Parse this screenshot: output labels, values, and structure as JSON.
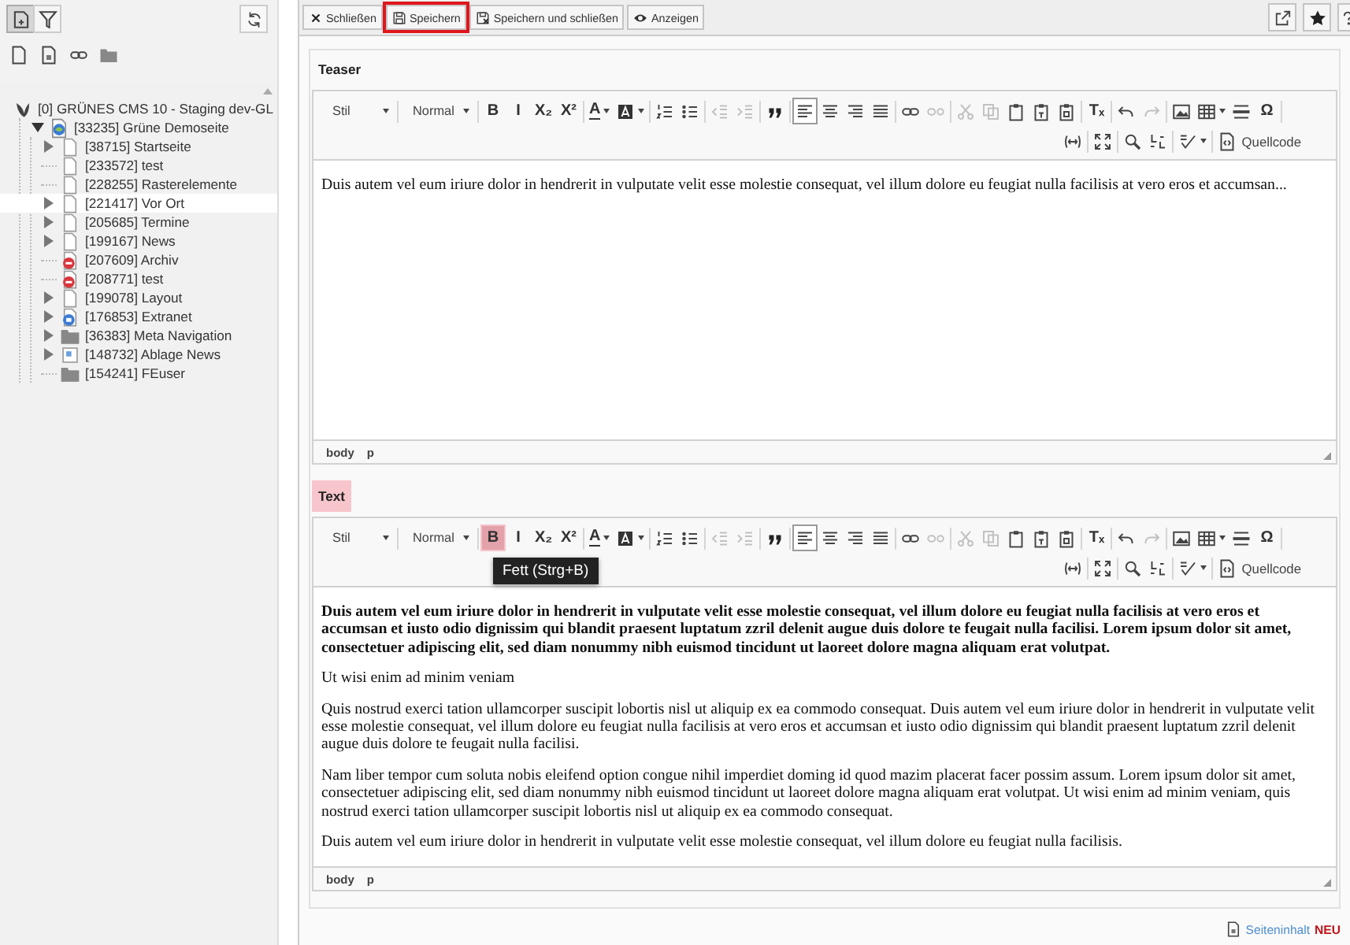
{
  "sidebar": {
    "toolbar": [
      {
        "selected": true
      },
      {
        "selected": false
      }
    ],
    "tree": {
      "label": "[0] GRÜNES CMS 10 - Staging dev-GL",
      "kind": "site",
      "selected": false,
      "children": [
        {
          "label": "[33235] Grüne Demoseite",
          "kind": "home",
          "expanded": true,
          "selected": false,
          "children": [
            {
              "label": "[38715] Startseite",
              "kind": "page",
              "expanded": false,
              "selected": false
            },
            {
              "label": "[233572] test",
              "kind": "page",
              "selected": false
            },
            {
              "label": "[228255] Rasterelemente",
              "kind": "page",
              "selected": false
            },
            {
              "label": "[221417] Vor Ort",
              "kind": "page",
              "expanded": false,
              "selected": true
            },
            {
              "label": "[205685] Termine",
              "kind": "page",
              "expanded": false,
              "selected": false
            },
            {
              "label": "[199167] News",
              "kind": "page",
              "expanded": false,
              "selected": false
            },
            {
              "label": "[207609] Archiv",
              "kind": "restricted",
              "selected": false
            },
            {
              "label": "[208771] test",
              "kind": "restricted",
              "selected": false
            },
            {
              "label": "[199078] Layout",
              "kind": "page",
              "expanded": false,
              "selected": false
            },
            {
              "label": "[176853] Extranet",
              "kind": "extranet",
              "expanded": false,
              "selected": false
            },
            {
              "label": "[36383] Meta Navigation",
              "kind": "folder",
              "expanded": false,
              "selected": false
            },
            {
              "label": "[148732] Ablage News",
              "kind": "news",
              "expanded": false,
              "selected": false
            },
            {
              "label": "[154241] FEuser",
              "kind": "folder",
              "selected": false
            }
          ]
        }
      ]
    }
  },
  "doc_header": {
    "buttons": [
      {
        "label": "Schließen",
        "focused": false
      },
      {
        "label": "Speichern",
        "focused": true
      },
      {
        "label": "Speichern und schließen",
        "focused": false
      },
      {
        "label": "Anzeigen",
        "focused": false
      }
    ]
  },
  "editors": [
    {
      "label": "Teaser",
      "highlighted": false,
      "toolbar": [
        [
          {
            "kind": "dropdown",
            "text": "Stil"
          },
          {
            "kind": "dropdown",
            "text": "Normal"
          },
          {
            "kind": "button",
            "text": "B",
            "disabled": false,
            "on": false,
            "hover": false
          },
          {
            "kind": "button",
            "text": "I",
            "disabled": false,
            "on": false,
            "hover": false
          },
          {
            "kind": "button",
            "text": "X₂",
            "disabled": false,
            "on": false,
            "hover": false
          },
          {
            "kind": "button",
            "text": "X²",
            "disabled": false,
            "on": false,
            "hover": false
          },
          {
            "kind": "button",
            "text": "A",
            "disabled": false,
            "on": false,
            "hover": false
          },
          {
            "kind": "button",
            "disabled": false,
            "on": false,
            "hover": false
          },
          {
            "kind": "button",
            "disabled": false,
            "on": false,
            "hover": false
          },
          {
            "kind": "button",
            "disabled": false,
            "on": false,
            "hover": false
          },
          {
            "kind": "button",
            "disabled": true,
            "on": false,
            "hover": false
          },
          {
            "kind": "button",
            "disabled": true,
            "on": false,
            "hover": false
          },
          {
            "kind": "button",
            "disabled": false,
            "on": false,
            "hover": false
          },
          {
            "kind": "button",
            "disabled": false,
            "on": true,
            "hover": false
          },
          {
            "kind": "button",
            "disabled": false,
            "on": false,
            "hover": false
          },
          {
            "kind": "button",
            "disabled": false,
            "on": false,
            "hover": false
          },
          {
            "kind": "button",
            "disabled": false,
            "on": false,
            "hover": false
          },
          {
            "kind": "button",
            "disabled": false,
            "on": false,
            "hover": false
          },
          {
            "kind": "button",
            "disabled": true,
            "on": false,
            "hover": false
          },
          {
            "kind": "button",
            "disabled": true,
            "on": false,
            "hover": false
          },
          {
            "kind": "button",
            "disabled": true,
            "on": false,
            "hover": false
          },
          {
            "kind": "button",
            "disabled": false,
            "on": false,
            "hover": false
          },
          {
            "kind": "button",
            "disabled": false,
            "on": false,
            "hover": false
          },
          {
            "kind": "button",
            "disabled": false,
            "on": false,
            "hover": false
          },
          {
            "kind": "button",
            "text": "Tₓ",
            "disabled": false,
            "on": false,
            "hover": false
          },
          {
            "kind": "button",
            "disabled": false,
            "on": false,
            "hover": false
          },
          {
            "kind": "button",
            "disabled": true,
            "on": false,
            "hover": false
          },
          {
            "kind": "button",
            "disabled": false,
            "on": false,
            "hover": false
          },
          {
            "kind": "button",
            "disabled": false,
            "on": false,
            "hover": false
          },
          {
            "kind": "button",
            "disabled": false,
            "on": false,
            "hover": false
          },
          {
            "kind": "button",
            "text": "Ω",
            "disabled": false,
            "on": false,
            "hover": false
          }
        ],
        [
          {
            "kind": "button",
            "disabled": false,
            "on": false,
            "hover": false
          },
          {
            "kind": "button",
            "disabled": false,
            "on": false,
            "hover": false
          },
          {
            "kind": "button",
            "disabled": false,
            "on": false,
            "hover": false
          },
          {
            "kind": "button",
            "disabled": false,
            "on": false,
            "hover": false
          },
          {
            "kind": "button",
            "disabled": false,
            "on": false,
            "hover": false
          },
          {
            "kind": "button",
            "text": "Quellcode",
            "disabled": false,
            "on": false,
            "hover": false
          }
        ]
      ],
      "paragraphs": [
        {
          "text": "Duis autem vel eum iriure dolor in hendrerit in vulputate velit esse molestie consequat, vel illum dolore eu feugiat nulla facilisis at vero eros et accumsan...",
          "bold": false
        }
      ],
      "path": [
        "body",
        "p"
      ]
    },
    {
      "label": "Text",
      "highlighted": true,
      "toolbar": [
        [
          {
            "kind": "dropdown",
            "text": "Stil"
          },
          {
            "kind": "dropdown",
            "text": "Normal"
          },
          {
            "kind": "button",
            "text": "B",
            "disabled": false,
            "on": false,
            "hover": true,
            "tooltip": "Fett (Strg+B)"
          },
          {
            "kind": "button",
            "text": "I",
            "disabled": false,
            "on": false,
            "hover": false
          },
          {
            "kind": "button",
            "text": "X₂",
            "disabled": false,
            "on": false,
            "hover": false
          },
          {
            "kind": "button",
            "text": "X²",
            "disabled": false,
            "on": false,
            "hover": false
          },
          {
            "kind": "button",
            "text": "A",
            "disabled": false,
            "on": false,
            "hover": false
          },
          {
            "kind": "button",
            "disabled": false,
            "on": false,
            "hover": false
          },
          {
            "kind": "button",
            "disabled": false,
            "on": false,
            "hover": false
          },
          {
            "kind": "button",
            "disabled": false,
            "on": false,
            "hover": false
          },
          {
            "kind": "button",
            "disabled": true,
            "on": false,
            "hover": false
          },
          {
            "kind": "button",
            "disabled": true,
            "on": false,
            "hover": false
          },
          {
            "kind": "button",
            "disabled": false,
            "on": false,
            "hover": false
          },
          {
            "kind": "button",
            "disabled": false,
            "on": true,
            "hover": false
          },
          {
            "kind": "button",
            "disabled": false,
            "on": false,
            "hover": false
          },
          {
            "kind": "button",
            "disabled": false,
            "on": false,
            "hover": false
          },
          {
            "kind": "button",
            "disabled": false,
            "on": false,
            "hover": false
          },
          {
            "kind": "button",
            "disabled": false,
            "on": false,
            "hover": false
          },
          {
            "kind": "button",
            "disabled": true,
            "on": false,
            "hover": false
          },
          {
            "kind": "button",
            "disabled": true,
            "on": false,
            "hover": false
          },
          {
            "kind": "button",
            "disabled": true,
            "on": false,
            "hover": false
          },
          {
            "kind": "button",
            "disabled": false,
            "on": false,
            "hover": false
          },
          {
            "kind": "button",
            "disabled": false,
            "on": false,
            "hover": false
          },
          {
            "kind": "button",
            "disabled": false,
            "on": false,
            "hover": false
          },
          {
            "kind": "button",
            "text": "Tₓ",
            "disabled": false,
            "on": false,
            "hover": false
          },
          {
            "kind": "button",
            "disabled": false,
            "on": false,
            "hover": false
          },
          {
            "kind": "button",
            "disabled": true,
            "on": false,
            "hover": false
          },
          {
            "kind": "button",
            "disabled": false,
            "on": false,
            "hover": false
          },
          {
            "kind": "button",
            "disabled": false,
            "on": false,
            "hover": false
          },
          {
            "kind": "button",
            "disabled": false,
            "on": false,
            "hover": false
          },
          {
            "kind": "button",
            "text": "Ω",
            "disabled": false,
            "on": false,
            "hover": false
          }
        ],
        [
          {
            "kind": "button",
            "disabled": false,
            "on": false,
            "hover": false
          },
          {
            "kind": "button",
            "disabled": false,
            "on": false,
            "hover": false
          },
          {
            "kind": "button",
            "disabled": false,
            "on": false,
            "hover": false
          },
          {
            "kind": "button",
            "disabled": false,
            "on": false,
            "hover": false
          },
          {
            "kind": "button",
            "disabled": false,
            "on": false,
            "hover": false
          },
          {
            "kind": "button",
            "text": "Quellcode",
            "disabled": false,
            "on": false,
            "hover": false
          }
        ]
      ],
      "paragraphs": [
        {
          "text": "Duis autem vel eum iriure dolor in hendrerit in vulputate velit esse molestie consequat, vel illum dolore eu feugiat nulla facilisis at vero eros et accumsan et iusto odio dignissim qui blandit praesent luptatum zzril delenit augue duis dolore te feugait nulla facilisi. Lorem ipsum dolor sit amet, consectetuer adipiscing elit, sed diam nonummy nibh euismod tincidunt ut laoreet dolore magna aliquam erat volutpat.",
          "bold": true
        },
        {
          "text": "Ut wisi enim ad minim veniam",
          "bold": false
        },
        {
          "text": "Quis nostrud exerci tation ullamcorper suscipit lobortis nisl ut aliquip ex ea commodo consequat. Duis autem vel eum iriure dolor in hendrerit in vulputate velit esse molestie consequat, vel illum dolore eu feugiat nulla facilisis at vero eros et accumsan et iusto odio dignissim qui blandit praesent luptatum zzril delenit augue duis dolore te feugait nulla facilisi.",
          "bold": false
        },
        {
          "text": "Nam liber tempor cum soluta nobis eleifend option congue nihil imperdiet doming id quod mazim placerat facer possim assum. Lorem ipsum dolor sit amet, consectetuer adipiscing elit, sed diam nonummy nibh euismod tincidunt ut laoreet dolore magna aliquam erat volutpat. Ut wisi enim ad minim veniam, quis nostrud exerci tation ullamcorper suscipit lobortis nisl ut aliquip ex ea commodo consequat.",
          "bold": false
        },
        {
          "text": "Duis autem vel eum iriure dolor in hendrerit in vulputate velit esse molestie consequat, vel illum dolore eu feugiat nulla facilisis.",
          "bold": false
        }
      ],
      "path": [
        "body",
        "p"
      ]
    }
  ],
  "footer": {
    "link": "Seiteninhalt",
    "badge": "NEU"
  }
}
